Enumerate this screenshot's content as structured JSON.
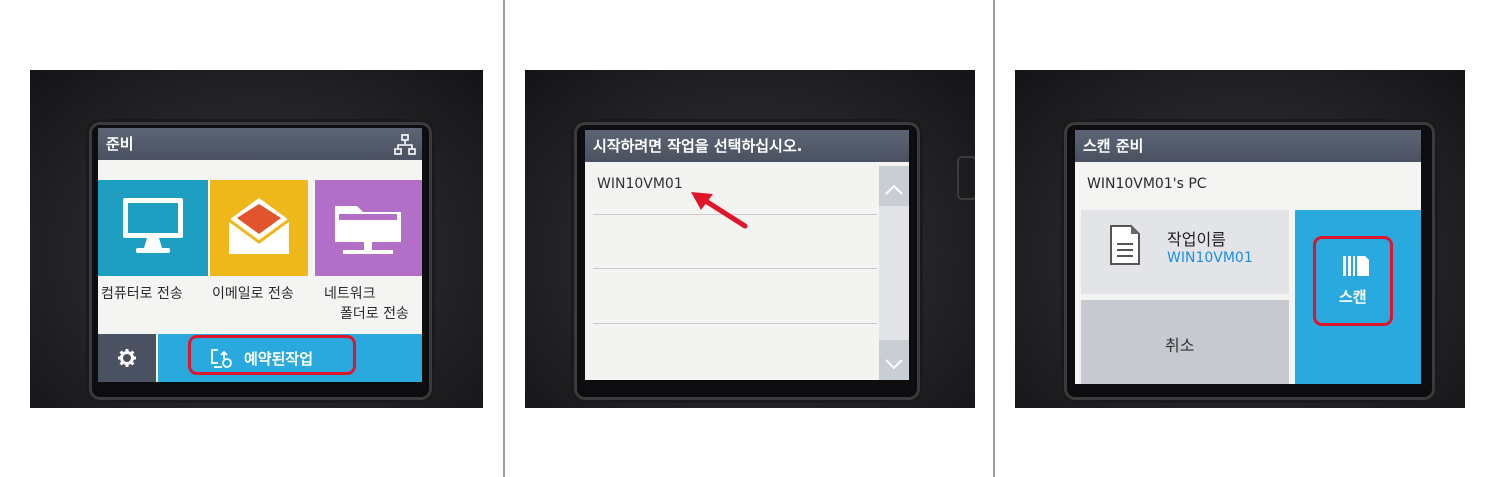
{
  "panel1": {
    "title": "준비",
    "tiles": [
      {
        "label": "컴퓨터로 전송"
      },
      {
        "label": "이메일로 전송"
      },
      {
        "label_line1": "네트워크",
        "label_line2": "폴더로 전송"
      }
    ],
    "scheduled_button": "예약된작업",
    "colors": {
      "computer": "#1e9ec0",
      "email": "#efb81a",
      "network": "#b26fc8",
      "bottom_bar": "#29a9de"
    }
  },
  "panel2": {
    "title": "시작하려면 작업을 선택하십시오.",
    "items": [
      "WIN10VM01"
    ]
  },
  "panel3": {
    "title": "스캔 준비",
    "pc_name": "WIN10VM01's PC",
    "job_label": "작업이름",
    "job_value": "WIN10VM01",
    "cancel_label": "취소",
    "scan_label": "스캔",
    "colors": {
      "scan": "#29a9de",
      "job_value": "#1a8fe0"
    }
  },
  "icons": [
    "monitor-icon",
    "envelope-icon",
    "folder-icon",
    "network-icon",
    "gear-icon",
    "scheduled-job-icon",
    "chevron-up-icon",
    "chevron-down-icon",
    "document-icon",
    "scan-icon",
    "red-arrow-icon"
  ]
}
